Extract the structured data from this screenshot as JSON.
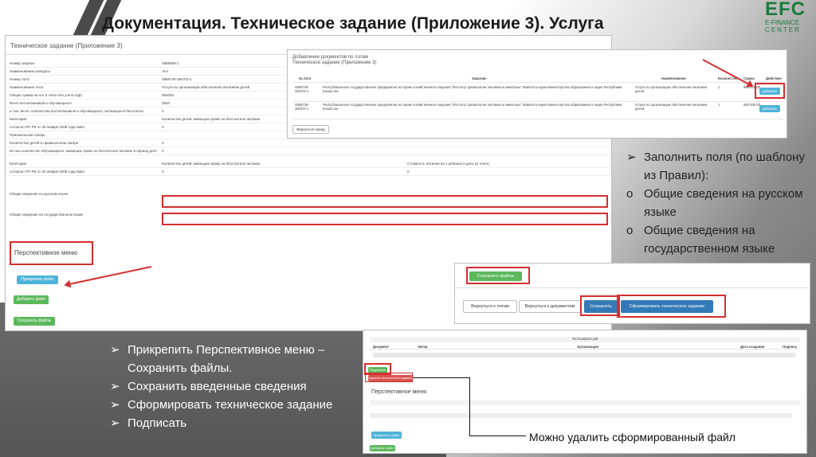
{
  "slide": {
    "title": "Документация. Техническое задание (Приложение 3). Услуга",
    "logo_main": "EFC",
    "logo_sub1": "E-FINANCE",
    "logo_sub2": "CENTER"
  },
  "main_form": {
    "title": "Техническое задание (Приложение 3)",
    "rows": [
      {
        "label": "Номер закупки",
        "value": "4868059-1"
      },
      {
        "label": "Наименование конкурса",
        "value": "тест"
      },
      {
        "label": "Номер лота",
        "value": "4868745-ЗКОП2-1"
      },
      {
        "label": "Наименование лота",
        "value": "Услуги по организации обеспечения питанием детей"
      },
      {
        "label": "Общая сумма на лот в тенге без учета НДС",
        "value": "850000"
      },
      {
        "label": "Всего воспитанников и обучающихся",
        "value": "3500"
      },
      {
        "label": "в том числе, количества воспитанников и обучающихся, питающихся бесплатно",
        "value": "0"
      },
      {
        "label": "Категория",
        "value": "Количество детей, имеющих право на бесплатное питание"
      },
      {
        "label": "согласно ПП РК от 25 января 2008 года №64",
        "value": "0"
      },
      {
        "label": "Пришкольный лагерь",
        "value": ""
      },
      {
        "label": "Количество детей в пришкольном лагере",
        "value": "0"
      },
      {
        "label": "Из них количество обучающихся, имеющих право на бесплатное питание в период деятельности пришкольного лагеря",
        "value": "0"
      },
      {
        "label": "Категория",
        "value": "Количество детей, имеющих право на бесплатное питание",
        "value2": "Стоимость питания на 1 ребенка в день (в тенге)"
      },
      {
        "label": "согласно ПП РК от 25 января 2008 года №64",
        "value": "0",
        "value2": "0"
      },
      {
        "label": "Общие сведения на русском языке",
        "value": ""
      },
      {
        "label": "Общие сведения на государственном языке",
        "value": ""
      }
    ],
    "persp_menu": "Перспективное меню",
    "attach_btn": "Прикрепить файл",
    "add_btn": "Добавить файл",
    "save_files_btn": "Сохранить файлы"
  },
  "docs_panel": {
    "title": "Добавление документов по лотам",
    "subtitle": "Техническое задание (Приложение 3)",
    "headers": [
      "№ лота",
      "Заказчик",
      "Наименование",
      "Количество",
      "Сумма",
      "Действие"
    ],
    "rows": [
      {
        "lot": "4868745-ЗКОП2-1",
        "customer": "Республиканское государственное предприятие на праве хозяйственного ведения \"Институт физиологии человека и животных\" Комитета науки Министерства образования и науки Республики Казахстан",
        "name": "Услуги по организации обеспечения питанием детей",
        "qty": "1",
        "sum": "850 000.00",
        "action": "Добавить"
      },
      {
        "lot": "4868745-ЗКОП2-1",
        "customer": "Республиканское государственное предприятие на праве хозяйственного ведения \"Институт физиологии человека и животных\" Комитета науки Министерства образования и науки Республики Казахстан",
        "name": "Услуги по организации обеспечения питанием детей",
        "qty": "1",
        "sum": "850 000.00",
        "action": "Добавить"
      }
    ],
    "back_btn": "Вернуться назад"
  },
  "right_bullets": [
    {
      "marker": "➢",
      "text": "Заполнить поля (по шаблону из Правил):"
    },
    {
      "marker": "o",
      "text": "Общие сведения на русском языке"
    },
    {
      "marker": "o",
      "text": "Общие сведения на государственном языке"
    }
  ],
  "save_panel": {
    "save_files": "Сохранить файлы",
    "back_lots": "Вернуться к лотам",
    "back_docs": "Вернуться к документам",
    "save": "Сохранить",
    "generate": "Сформировать техническое задание"
  },
  "bottom_panel": {
    "file_name": "Techzadanie.pdf",
    "headers": [
      "Документ",
      "Автор",
      "Организация",
      "Дата создания",
      "Подпись"
    ],
    "sign_btn": "Подписать",
    "delete_btn": "Удалить техническое задание",
    "persp_menu": "Перспективное меню",
    "attach_btn": "Прикрепить файл",
    "add_btn": "Добавить файл",
    "caption": "Можно удалить сформированный файл"
  },
  "left_bullets": [
    {
      "marker": "➢",
      "text": "Прикрепить Перспективное меню – Сохранить файлы."
    },
    {
      "marker": "➢",
      "text": "Сохранить введенные сведения"
    },
    {
      "marker": "➢",
      "text": "Сформировать техническое задание"
    },
    {
      "marker": "➢",
      "text": "Подписать"
    }
  ]
}
